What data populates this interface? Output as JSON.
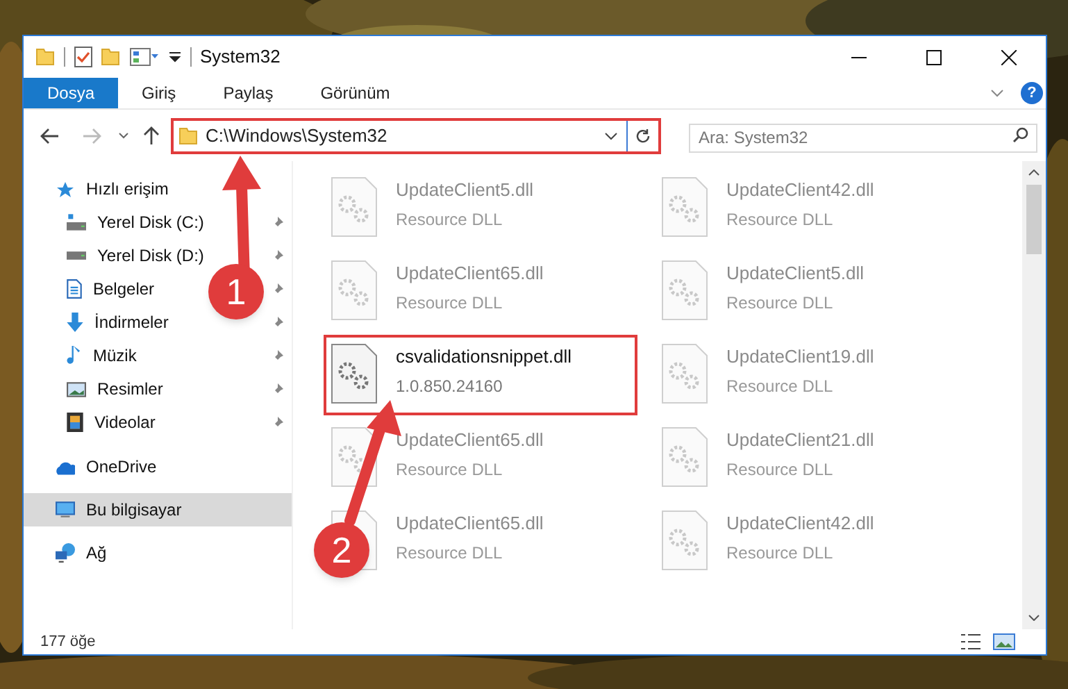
{
  "window": {
    "title": "System32"
  },
  "ribbon_tabs": [
    {
      "label": "Dosya",
      "selected": true
    },
    {
      "label": "Giriş",
      "selected": false
    },
    {
      "label": "Paylaş",
      "selected": false
    },
    {
      "label": "Görünüm",
      "selected": false
    }
  ],
  "help_button": {
    "label": "?"
  },
  "address_bar": {
    "path": "C:\\Windows\\System32",
    "highlighted": true
  },
  "search": {
    "placeholder": "Ara: System32"
  },
  "sidebar": {
    "items": [
      {
        "label": "Hızlı erişim",
        "selected": false,
        "children": [
          {
            "label": "Yerel Disk (C:)",
            "pinned": true,
            "selected": false
          },
          {
            "label": "Yerel Disk (D:)",
            "pinned": true,
            "selected": false
          },
          {
            "label": "Belgeler",
            "pinned": true,
            "selected": false
          },
          {
            "label": "İndirmeler",
            "pinned": true,
            "selected": false
          },
          {
            "label": "Müzik",
            "pinned": true,
            "selected": false
          },
          {
            "label": "Resimler",
            "pinned": true,
            "selected": false
          },
          {
            "label": "Videolar",
            "pinned": true,
            "selected": false
          }
        ]
      },
      {
        "label": "OneDrive",
        "selected": false
      },
      {
        "label": "Bu bilgisayar",
        "selected": true
      },
      {
        "label": "Ağ",
        "selected": false
      }
    ]
  },
  "files": [
    {
      "name": "UpdateClient5.dll",
      "detail": "Resource DLL",
      "blurred": true,
      "highlighted": false
    },
    {
      "name": "UpdateClient42.dll",
      "detail": "Resource DLL",
      "blurred": true,
      "highlighted": false
    },
    {
      "name": "UpdateClient65.dll",
      "detail": "Resource DLL",
      "blurred": true,
      "highlighted": false
    },
    {
      "name": "UpdateClient5.dll",
      "detail": "Resource DLL",
      "blurred": true,
      "highlighted": false
    },
    {
      "name": "csvalidationsnippet.dll",
      "detail": "1.0.850.24160",
      "blurred": false,
      "highlighted": true
    },
    {
      "name": "UpdateClient19.dll",
      "detail": "Resource DLL",
      "blurred": true,
      "highlighted": false
    },
    {
      "name": "UpdateClient65.dll",
      "detail": "Resource DLL",
      "blurred": true,
      "highlighted": false
    },
    {
      "name": "UpdateClient21.dll",
      "detail": "Resource DLL",
      "blurred": true,
      "highlighted": false
    },
    {
      "name": "UpdateClient65.dll",
      "detail": "Resource DLL",
      "blurred": true,
      "highlighted": false
    },
    {
      "name": "UpdateClient42.dll",
      "detail": "Resource DLL",
      "blurred": true,
      "highlighted": false
    }
  ],
  "status_bar": {
    "item_count": "177 öğe"
  },
  "annotations": [
    {
      "number": "1"
    },
    {
      "number": "2"
    }
  ]
}
